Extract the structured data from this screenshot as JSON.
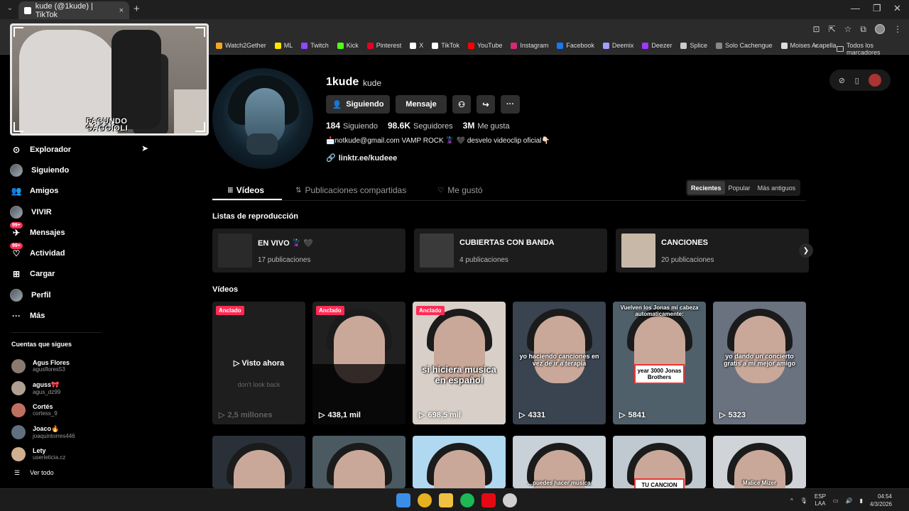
{
  "browser": {
    "tab_title": "kude (@1kude) | TikTok",
    "tab_close": "×",
    "new_tab": "+",
    "bookmarks": [
      {
        "label": "Watch2Gether",
        "color": "#f5a623"
      },
      {
        "label": "ML",
        "color": "#ffe600"
      },
      {
        "label": "Twitch",
        "color": "#9146ff"
      },
      {
        "label": "Kick",
        "color": "#53fc18"
      },
      {
        "label": "Pinterest",
        "color": "#e60023"
      },
      {
        "label": "X",
        "color": "#ffffff"
      },
      {
        "label": "TikTok",
        "color": "#ffffff"
      },
      {
        "label": "YouTube",
        "color": "#ff0000"
      },
      {
        "label": "Instagram",
        "color": "#d62976"
      },
      {
        "label": "Facebook",
        "color": "#1877f2"
      },
      {
        "label": "Deemix",
        "color": "#a0a0ff"
      },
      {
        "label": "Deezer",
        "color": "#a238ff"
      },
      {
        "label": "Splice",
        "color": "#cccccc"
      },
      {
        "label": "Solo Cachengue",
        "color": "#888888"
      },
      {
        "label": "Moises Acapella",
        "color": "#dddddd"
      }
    ],
    "more": "»",
    "all_bookmarks": "Todos los marcadores"
  },
  "webcam": {
    "logo_line1": "FACUNDO",
    "logo_line2": "GAGGIOLI"
  },
  "sidebar": {
    "items": [
      {
        "label": "Explorador",
        "icon": "compass-icon",
        "glyph": "⊙"
      },
      {
        "label": "Siguiendo",
        "icon": "following-avatar",
        "glyph": ""
      },
      {
        "label": "Amigos",
        "icon": "friends-icon",
        "glyph": "👥"
      },
      {
        "label": "VIVIR",
        "icon": "live-avatar",
        "glyph": ""
      },
      {
        "label": "Mensajes",
        "icon": "messages-icon",
        "glyph": "✈",
        "badge": "99+"
      },
      {
        "label": "Actividad",
        "icon": "activity-icon",
        "glyph": "♡",
        "badge": "99+"
      },
      {
        "label": "Cargar",
        "icon": "upload-icon",
        "glyph": "⊞"
      },
      {
        "label": "Perfil",
        "icon": "profile-avatar",
        "glyph": ""
      },
      {
        "label": "Más",
        "icon": "more-icon",
        "glyph": "···"
      }
    ],
    "following_title": "Cuentas que sigues",
    "following": [
      {
        "name": "Agus Flores",
        "user": "agusflores53",
        "color": "#8a7a70"
      },
      {
        "name": "aguss🎀",
        "user": "agus_dz99",
        "color": "#b0a090"
      },
      {
        "name": "Cortés",
        "user": "cortess_9",
        "color": "#c07060"
      },
      {
        "name": "Joaco🔥",
        "user": "joaquintorres446",
        "color": "#607080"
      },
      {
        "name": "Lety",
        "user": "userleticia.cz",
        "color": "#d0b090"
      }
    ],
    "see_all": "Ver todo"
  },
  "profile": {
    "username": "1kude",
    "nickname": "kude",
    "btn_following": "Siguiendo",
    "btn_message": "Mensaje",
    "stats": [
      {
        "value": "184",
        "label": "Siguiendo"
      },
      {
        "value": "98.6K",
        "label": "Seguidores"
      },
      {
        "value": "3M",
        "label": "Me gusta"
      }
    ],
    "bio": "📩notkude@gmail.com VAMP ROCK 🦹 🖤 desvelo videoclip oficial👇🏻",
    "link": "linktr.ee/kudeee"
  },
  "tabs": [
    {
      "label": "Vídeos",
      "glyph": "⦙⦙⦙",
      "active": true
    },
    {
      "label": "Publicaciones compartidas",
      "glyph": "⇅",
      "active": false
    },
    {
      "label": "Me gustó",
      "glyph": "♡",
      "active": false
    }
  ],
  "sort": [
    {
      "label": "Recientes",
      "active": true
    },
    {
      "label": "Popular",
      "active": false
    },
    {
      "label": "Más antiguos",
      "active": false
    }
  ],
  "playlists_title": "Listas de reproducción",
  "playlists": [
    {
      "title": "EN VIVO 🦹 🖤",
      "count": "17 publicaciones",
      "thumb": "#2a2a2a"
    },
    {
      "title": "CUBIERTAS CON BANDA",
      "count": "4 publicaciones",
      "thumb": "#3a3a3a"
    },
    {
      "title": "CANCIONES",
      "count": "20 publicaciones",
      "thumb": "#c8b8a8"
    }
  ],
  "videos_title": "Vídeos",
  "videos": [
    {
      "label": "Anclado",
      "views": "2,5 millones",
      "watched": "Visto ahora",
      "faded": "don't look back",
      "bg": "#1e1e1e",
      "caption": ""
    },
    {
      "label": "Anclado",
      "views": "438,1 mil",
      "caption": "",
      "bg": "#202020"
    },
    {
      "label": "Anclado",
      "views": "698,5 mil",
      "caption": "si hiciera musica en español",
      "bg": "#d8d0c8"
    },
    {
      "label": "",
      "views": "4331",
      "caption": "yo haciendo canciones en vez de ir a terapia",
      "bg": "#3a4450"
    },
    {
      "label": "",
      "views": "5841",
      "caption": "Vuelven los Jonas mi cabeza automaticamente:",
      "box": "year 3000 Jonas Brothers",
      "bg": "#50606a"
    },
    {
      "label": "",
      "views": "5323",
      "caption": "yo dando un concierto gratis a mi mejor amigo",
      "bg": "#6a7280"
    }
  ],
  "videos_row2": [
    {
      "bg": "#2a3038",
      "caption": ""
    },
    {
      "bg": "#4a5a60",
      "caption": ""
    },
    {
      "bg": "#b0d8f0",
      "caption": ""
    },
    {
      "bg": "#c8d0d8",
      "caption": "...puedes hacer musica"
    },
    {
      "bg": "#c0c8d0",
      "caption": "",
      "box": "TU CANCION"
    },
    {
      "bg": "#d0d4d8",
      "caption": "Malice Mizer"
    }
  ],
  "taskbar": {
    "lang": "ESP",
    "lang2": "LAA",
    "time": "04:54",
    "date": "4/3/2026",
    "apps": [
      "#3b8ee8",
      "#e8b020",
      "#f0c040",
      "#1db954",
      "#e50914",
      "#d0d0d0"
    ]
  }
}
